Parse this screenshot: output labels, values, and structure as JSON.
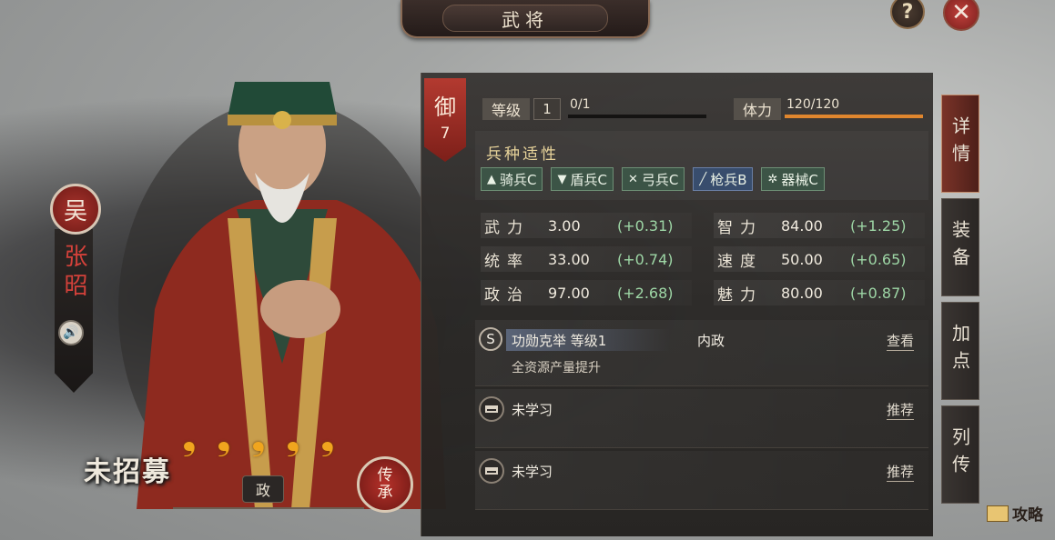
{
  "header": {
    "title": "武将"
  },
  "controls": {
    "help_label": "?",
    "close_label": "✕"
  },
  "general": {
    "faction": "吴",
    "name": "张昭",
    "stars": 5,
    "star_glyph": "❟",
    "recruit_status": "未招募",
    "role": "政",
    "inherit_label": "传承"
  },
  "rank": {
    "label": "御",
    "value": "7"
  },
  "level": {
    "label": "等级",
    "value": "1",
    "exp": "0/1",
    "exp_fraction": 0
  },
  "stamina": {
    "label": "体力",
    "value": "120/120",
    "fraction": 1.0,
    "bar_color": "#e0862e"
  },
  "aptitude": {
    "title": "兵种适性",
    "items": [
      {
        "icon": "horse-icon",
        "glyph": "▲",
        "label": "骑兵C",
        "grade": "C"
      },
      {
        "icon": "shield-icon",
        "glyph": "▼",
        "label": "盾兵C",
        "grade": "C"
      },
      {
        "icon": "bow-icon",
        "glyph": "✕",
        "label": "弓兵C",
        "grade": "C"
      },
      {
        "icon": "spear-icon",
        "glyph": "╱",
        "label": "枪兵B",
        "grade": "B"
      },
      {
        "icon": "gear-icon",
        "glyph": "✲",
        "label": "器械C",
        "grade": "C"
      }
    ]
  },
  "stats": [
    {
      "name": "武力",
      "value": "3.00",
      "growth": "(+0.31)"
    },
    {
      "name": "智力",
      "value": "84.00",
      "growth": "(+1.25)"
    },
    {
      "name": "统率",
      "value": "33.00",
      "growth": "(+0.74)"
    },
    {
      "name": "速度",
      "value": "50.00",
      "growth": "(+0.65)"
    },
    {
      "name": "政治",
      "value": "97.00",
      "growth": "(+2.68)"
    },
    {
      "name": "魅力",
      "value": "80.00",
      "growth": "(+0.87)"
    }
  ],
  "skills": [
    {
      "badge": "S",
      "name": "功勋克举 等级1",
      "type": "内政",
      "desc": "全资源产量提升",
      "link": "查看"
    },
    {
      "name": "未学习",
      "link": "推荐"
    },
    {
      "name": "未学习",
      "link": "推荐"
    }
  ],
  "tabs": [
    "详情",
    "装备",
    "加点",
    "列传"
  ],
  "footer": {
    "strategy_label": "攻略"
  }
}
